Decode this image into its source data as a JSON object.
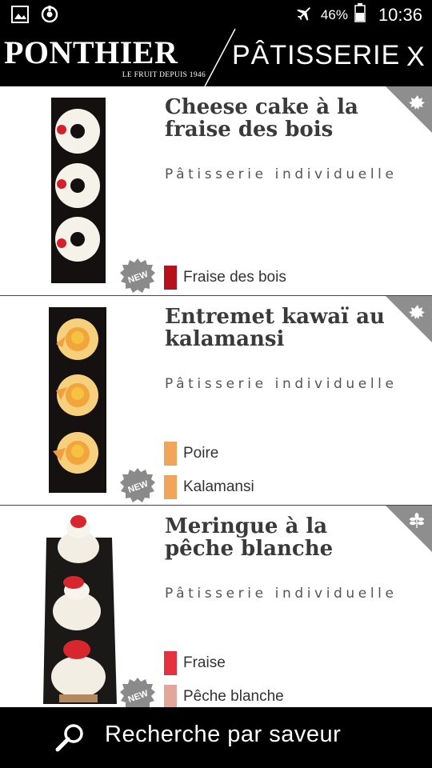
{
  "status_bar": {
    "battery_percent": "46%",
    "time": "10:36",
    "icons": [
      "gallery-icon",
      "sync-icon",
      "airplane-mode-icon",
      "battery-icon"
    ]
  },
  "header": {
    "brand": "PONTHIER",
    "tagline": "LE FRUIT DEPUIS 1946",
    "title": "PÂTISSERIE",
    "close_label": "X"
  },
  "products": [
    {
      "title": "Cheese cake à la fraise des bois",
      "category": "Pâtisserie individuelle",
      "new_badge": "NEW",
      "badge_icon": "maple-leaf-icon",
      "flavors": [
        {
          "label": "Fraise des bois",
          "color": "#b5121b"
        }
      ]
    },
    {
      "title": "Entremet kawaï au kalamansi",
      "category": "Pâtisserie individuelle",
      "new_badge": "NEW",
      "badge_icon": "maple-leaf-icon",
      "flavors": [
        {
          "label": "Poire",
          "color": "#f0a55a"
        },
        {
          "label": "Kalamansi",
          "color": "#f0a55a"
        }
      ]
    },
    {
      "title": "Meringue à la pêche blanche",
      "category": "Pâtisserie individuelle",
      "new_badge": "NEW",
      "badge_icon": "leaf-sprig-icon",
      "flavors": [
        {
          "label": "Fraise",
          "color": "#e4313f"
        },
        {
          "label": "Pêche blanche",
          "color": "#e3a79a"
        }
      ]
    }
  ],
  "search_bar": {
    "label": "Recherche par saveur",
    "icon": "search-icon"
  }
}
